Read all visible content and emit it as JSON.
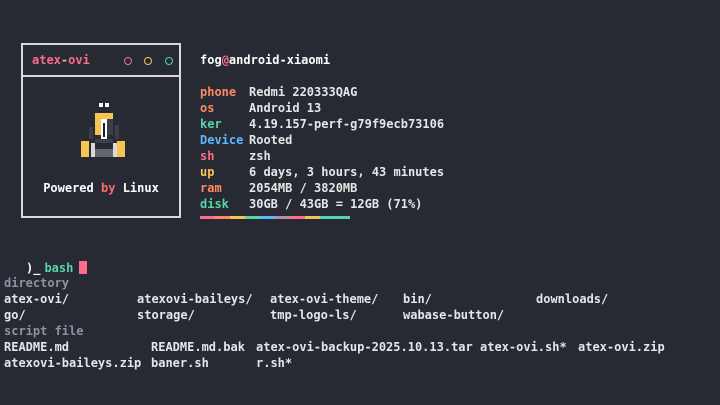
{
  "logo": {
    "brand_part1": "atex",
    "brand_sep": "-",
    "brand_part2": "ovi",
    "powered_prefix": "Powered",
    "powered_by": "by",
    "powered_suffix": "Linux",
    "dot_colors": [
      "#ff6b8b",
      "#f6c453",
      "#58d4a6"
    ]
  },
  "host": {
    "user": "fog",
    "at": "@",
    "machine": "android-xiaomi"
  },
  "info": [
    {
      "key": "phone",
      "value": "Redmi 220333QAG",
      "color": "#ff8a65"
    },
    {
      "key": "os",
      "value": "Android 13",
      "color": "#ff8a65"
    },
    {
      "key": "ker",
      "value": "4.19.157-perf-g79f9ecb73106",
      "color": "#58d4a6"
    },
    {
      "key": "Device",
      "value": "Rooted",
      "color": "#5bb8ff"
    },
    {
      "key": "sh",
      "value": "zsh",
      "color": "#ff6b8b"
    },
    {
      "key": "up",
      "value": "6 days, 3 hours, 43 minutes",
      "color": "#f6c453"
    },
    {
      "key": "ram",
      "value": "2054MB / 3820MB",
      "color": "#ff8a65"
    },
    {
      "key": "disk",
      "value": "30GB / 43GB = 12GB (71%)",
      "color": "#58d4a6"
    }
  ],
  "color_bar": [
    "#ff6b8b",
    "#ff8a65",
    "#f6c453",
    "#58d4a6",
    "#5bb8ff",
    "#b48ead",
    "#ff6b8b",
    "#f6c453",
    "#58d4a6",
    "#58d4a6"
  ],
  "prompt": {
    "symbol": ")_",
    "shell": "bash"
  },
  "listing": {
    "directory_label": "directory",
    "directories": [
      "atex-ovi/",
      "atexovi-baileys/",
      "atex-ovi-theme/",
      "bin/",
      "downloads/",
      "go/",
      "storage/",
      "tmp-logo-ls/",
      "wabase-button/"
    ],
    "files_label": "script file",
    "files": [
      "README.md",
      "README.md.bak",
      "atex-ovi-backup-2025.10.13.tar",
      "atex-ovi.sh*",
      "atex-ovi.zip",
      "atexovi-baileys.zip",
      "baner.sh",
      "r.sh*"
    ]
  }
}
